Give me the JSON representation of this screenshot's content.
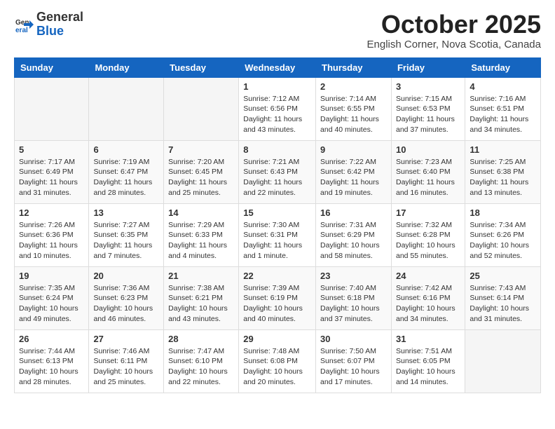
{
  "header": {
    "logo_general": "General",
    "logo_blue": "Blue",
    "month_title": "October 2025",
    "location": "English Corner, Nova Scotia, Canada"
  },
  "weekdays": [
    "Sunday",
    "Monday",
    "Tuesday",
    "Wednesday",
    "Thursday",
    "Friday",
    "Saturday"
  ],
  "weeks": [
    [
      {
        "day": "",
        "content": ""
      },
      {
        "day": "",
        "content": ""
      },
      {
        "day": "",
        "content": ""
      },
      {
        "day": "1",
        "content": "Sunrise: 7:12 AM\nSunset: 6:56 PM\nDaylight: 11 hours and 43 minutes."
      },
      {
        "day": "2",
        "content": "Sunrise: 7:14 AM\nSunset: 6:55 PM\nDaylight: 11 hours and 40 minutes."
      },
      {
        "day": "3",
        "content": "Sunrise: 7:15 AM\nSunset: 6:53 PM\nDaylight: 11 hours and 37 minutes."
      },
      {
        "day": "4",
        "content": "Sunrise: 7:16 AM\nSunset: 6:51 PM\nDaylight: 11 hours and 34 minutes."
      }
    ],
    [
      {
        "day": "5",
        "content": "Sunrise: 7:17 AM\nSunset: 6:49 PM\nDaylight: 11 hours and 31 minutes."
      },
      {
        "day": "6",
        "content": "Sunrise: 7:19 AM\nSunset: 6:47 PM\nDaylight: 11 hours and 28 minutes."
      },
      {
        "day": "7",
        "content": "Sunrise: 7:20 AM\nSunset: 6:45 PM\nDaylight: 11 hours and 25 minutes."
      },
      {
        "day": "8",
        "content": "Sunrise: 7:21 AM\nSunset: 6:43 PM\nDaylight: 11 hours and 22 minutes."
      },
      {
        "day": "9",
        "content": "Sunrise: 7:22 AM\nSunset: 6:42 PM\nDaylight: 11 hours and 19 minutes."
      },
      {
        "day": "10",
        "content": "Sunrise: 7:23 AM\nSunset: 6:40 PM\nDaylight: 11 hours and 16 minutes."
      },
      {
        "day": "11",
        "content": "Sunrise: 7:25 AM\nSunset: 6:38 PM\nDaylight: 11 hours and 13 minutes."
      }
    ],
    [
      {
        "day": "12",
        "content": "Sunrise: 7:26 AM\nSunset: 6:36 PM\nDaylight: 11 hours and 10 minutes."
      },
      {
        "day": "13",
        "content": "Sunrise: 7:27 AM\nSunset: 6:35 PM\nDaylight: 11 hours and 7 minutes."
      },
      {
        "day": "14",
        "content": "Sunrise: 7:29 AM\nSunset: 6:33 PM\nDaylight: 11 hours and 4 minutes."
      },
      {
        "day": "15",
        "content": "Sunrise: 7:30 AM\nSunset: 6:31 PM\nDaylight: 11 hours and 1 minute."
      },
      {
        "day": "16",
        "content": "Sunrise: 7:31 AM\nSunset: 6:29 PM\nDaylight: 10 hours and 58 minutes."
      },
      {
        "day": "17",
        "content": "Sunrise: 7:32 AM\nSunset: 6:28 PM\nDaylight: 10 hours and 55 minutes."
      },
      {
        "day": "18",
        "content": "Sunrise: 7:34 AM\nSunset: 6:26 PM\nDaylight: 10 hours and 52 minutes."
      }
    ],
    [
      {
        "day": "19",
        "content": "Sunrise: 7:35 AM\nSunset: 6:24 PM\nDaylight: 10 hours and 49 minutes."
      },
      {
        "day": "20",
        "content": "Sunrise: 7:36 AM\nSunset: 6:23 PM\nDaylight: 10 hours and 46 minutes."
      },
      {
        "day": "21",
        "content": "Sunrise: 7:38 AM\nSunset: 6:21 PM\nDaylight: 10 hours and 43 minutes."
      },
      {
        "day": "22",
        "content": "Sunrise: 7:39 AM\nSunset: 6:19 PM\nDaylight: 10 hours and 40 minutes."
      },
      {
        "day": "23",
        "content": "Sunrise: 7:40 AM\nSunset: 6:18 PM\nDaylight: 10 hours and 37 minutes."
      },
      {
        "day": "24",
        "content": "Sunrise: 7:42 AM\nSunset: 6:16 PM\nDaylight: 10 hours and 34 minutes."
      },
      {
        "day": "25",
        "content": "Sunrise: 7:43 AM\nSunset: 6:14 PM\nDaylight: 10 hours and 31 minutes."
      }
    ],
    [
      {
        "day": "26",
        "content": "Sunrise: 7:44 AM\nSunset: 6:13 PM\nDaylight: 10 hours and 28 minutes."
      },
      {
        "day": "27",
        "content": "Sunrise: 7:46 AM\nSunset: 6:11 PM\nDaylight: 10 hours and 25 minutes."
      },
      {
        "day": "28",
        "content": "Sunrise: 7:47 AM\nSunset: 6:10 PM\nDaylight: 10 hours and 22 minutes."
      },
      {
        "day": "29",
        "content": "Sunrise: 7:48 AM\nSunset: 6:08 PM\nDaylight: 10 hours and 20 minutes."
      },
      {
        "day": "30",
        "content": "Sunrise: 7:50 AM\nSunset: 6:07 PM\nDaylight: 10 hours and 17 minutes."
      },
      {
        "day": "31",
        "content": "Sunrise: 7:51 AM\nSunset: 6:05 PM\nDaylight: 10 hours and 14 minutes."
      },
      {
        "day": "",
        "content": ""
      }
    ]
  ]
}
